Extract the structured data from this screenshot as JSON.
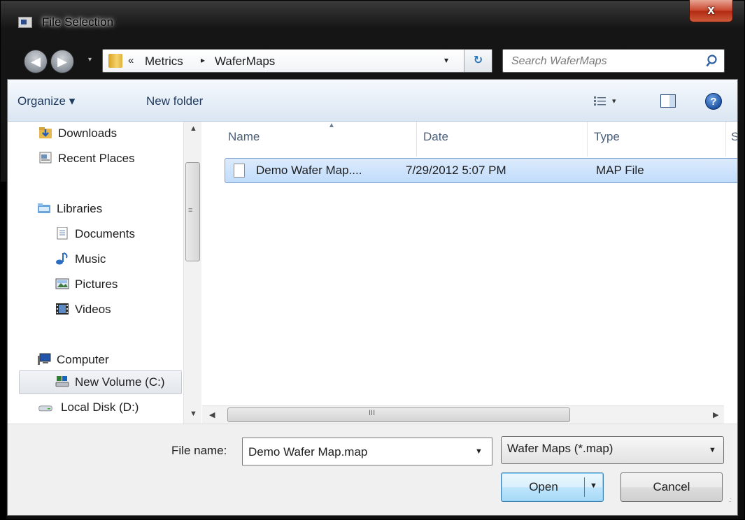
{
  "window": {
    "title": "File Selection",
    "close_glyph": "x"
  },
  "nav": {
    "back_glyph": "◀",
    "forward_glyph": "▶",
    "recent_glyph": "▾"
  },
  "address": {
    "chevron": "«",
    "crumbs": [
      "Metrics",
      "WaferMaps"
    ],
    "separator": "▸",
    "dropdown_glyph": "▾",
    "refresh_glyph": "↻"
  },
  "search": {
    "placeholder": "Search WaferMaps"
  },
  "toolbar": {
    "organize_label": "Organize ▾",
    "new_folder_label": "New folder",
    "views_drop_glyph": "▾",
    "help_glyph": "?"
  },
  "sidebar": {
    "items": [
      {
        "label": "Downloads",
        "icon": "downloads-icon"
      },
      {
        "label": "Recent Places",
        "icon": "recent-places-icon"
      },
      {
        "label": "Libraries",
        "icon": "libraries-icon"
      },
      {
        "label": "Documents",
        "icon": "documents-icon"
      },
      {
        "label": "Music",
        "icon": "music-icon"
      },
      {
        "label": "Pictures",
        "icon": "pictures-icon"
      },
      {
        "label": "Videos",
        "icon": "videos-icon"
      },
      {
        "label": "Computer",
        "icon": "computer-icon"
      },
      {
        "label": "New Volume (C:)",
        "icon": "drive-c-icon",
        "selected": true
      },
      {
        "label": "Local Disk (D:)",
        "icon": "drive-d-icon"
      }
    ]
  },
  "file_list": {
    "columns": [
      "Name",
      "Date",
      "Type",
      "S"
    ],
    "rows": [
      {
        "name": "Demo Wafer Map....",
        "date": "7/29/2012 5:07 PM",
        "type": "MAP File",
        "selected": true
      }
    ]
  },
  "scroll": {
    "up": "▲",
    "down": "▼",
    "left": "◀",
    "right": "▶",
    "grip_v": "≡",
    "grip_h": "III"
  },
  "footer": {
    "filename_label": "File name:",
    "filename_value": "Demo Wafer Map.map",
    "filename_drop": "▼",
    "filter_label": "Wafer Maps (*.map)",
    "filter_drop": "▼",
    "open_label": "Open",
    "open_drop": "▼",
    "cancel_label": "Cancel",
    "grip": ".:"
  },
  "colors": {
    "selection": "#c1dcfc",
    "toolbar": "#dbe6f3",
    "accent": "#3c7fb1"
  }
}
